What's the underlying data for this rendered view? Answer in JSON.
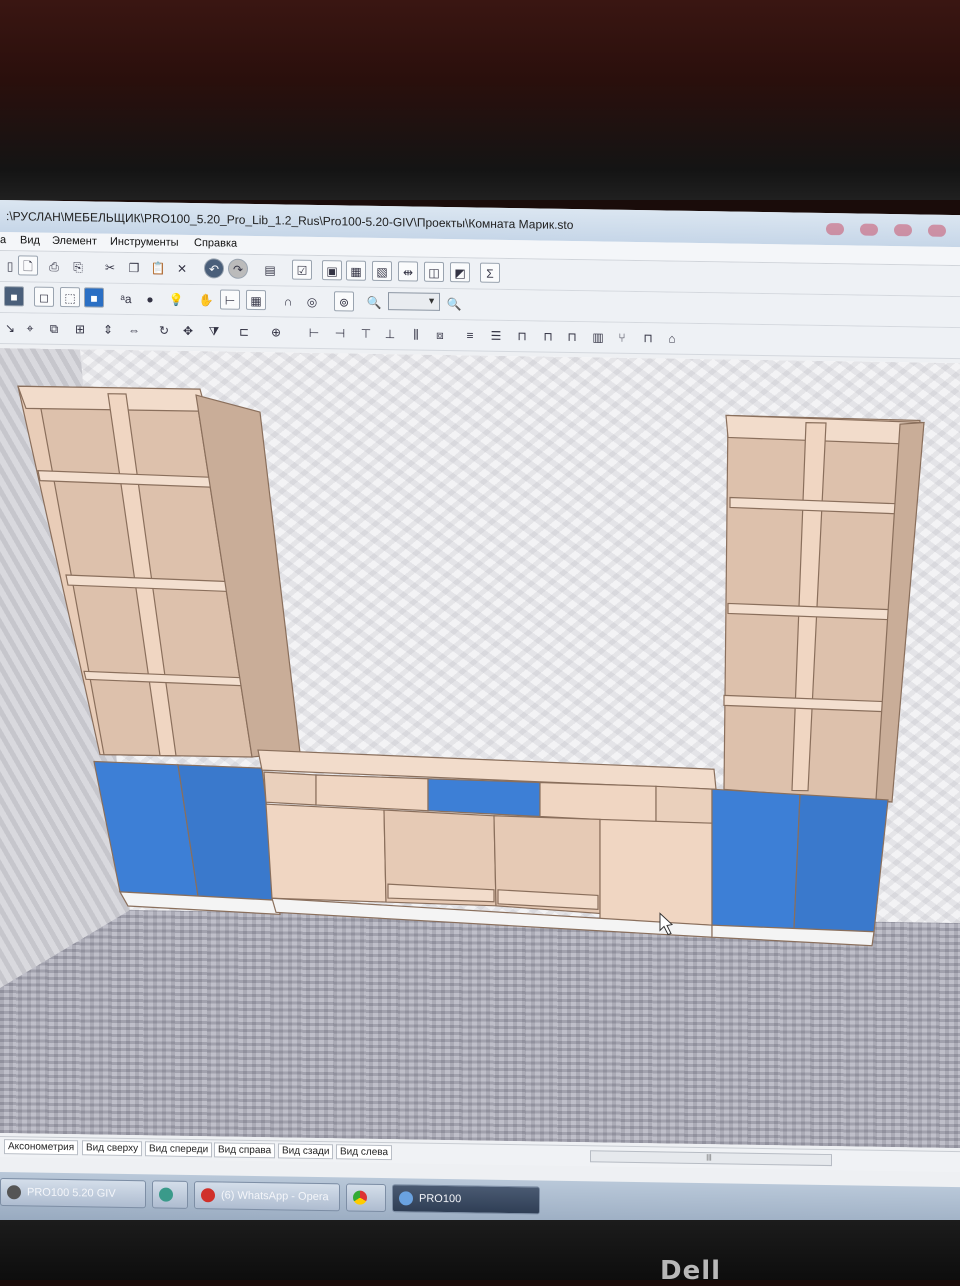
{
  "window": {
    "title": ":\\РУСЛАН\\МЕБЕЛЬЩИК\\PRO100_5.20_Pro_Lib_1.2_Rus\\Pro100-5.20-GIV\\Проекты\\Комната Марик.sto"
  },
  "menu": {
    "file_partial": "а",
    "view": "Вид",
    "element": "Элемент",
    "tools": "Инструменты",
    "help": "Справка"
  },
  "toolbar": {
    "sum_symbol": "Σ",
    "zoom_value": ""
  },
  "view_tabs": [
    "Аксонометрия",
    "Вид сверху",
    "Вид спереди",
    "Вид справа",
    "Вид сзади",
    "Вид слева"
  ],
  "scroll": {
    "thumb_glyph": "|||"
  },
  "taskbar": {
    "items": [
      {
        "label": "PRO100 5.20 GIV"
      },
      {
        "label": ""
      },
      {
        "label": "(6) WhatsApp - Opera"
      },
      {
        "label": ""
      },
      {
        "label": "PRO100"
      }
    ]
  },
  "monitor": {
    "brand": "Dell"
  },
  "colors": {
    "wood": "#f0d6c2",
    "wood_edge": "#d9b8a0",
    "door_blue": "#3d7fd6",
    "screen_bg": "#eef0f3"
  }
}
